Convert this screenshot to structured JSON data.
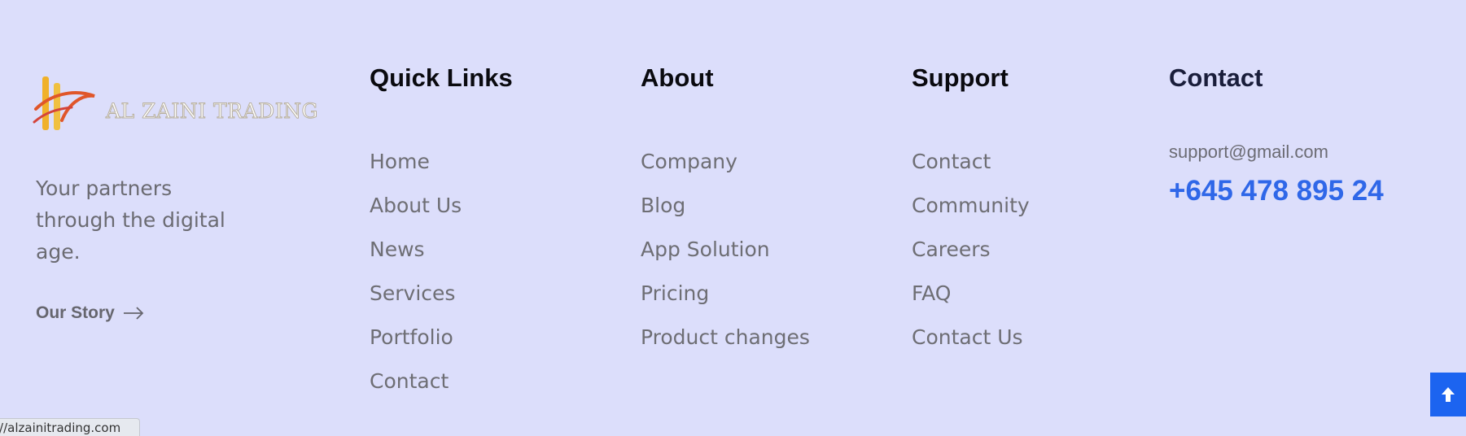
{
  "brand": {
    "logo_text": "AL ZAINI TRADING",
    "tagline": "Your partners through the digital age.",
    "story_link": "Our Story",
    "story_icon": "arrow-right-icon"
  },
  "columns": {
    "quick_links": {
      "heading": "Quick Links",
      "items": [
        "Home",
        "About Us",
        "News",
        "Services",
        "Portfolio",
        "Contact"
      ]
    },
    "about": {
      "heading": "About",
      "items": [
        "Company",
        "Blog",
        "App Solution",
        "Pricing",
        "Product changes"
      ]
    },
    "support": {
      "heading": "Support",
      "items": [
        "Contact",
        "Community",
        "Careers",
        "FAQ",
        "Contact Us"
      ]
    },
    "contact": {
      "heading": "Contact",
      "email": "support@gmail.com",
      "phone": "+645 478 895 24"
    }
  },
  "back_to_top": {
    "icon": "arrow-up-icon",
    "color": "#1c64f0"
  },
  "status_bar": {
    "url": "://alzainitrading.com"
  },
  "colors": {
    "background": "#dcdefb",
    "accent": "#2f67e8"
  }
}
